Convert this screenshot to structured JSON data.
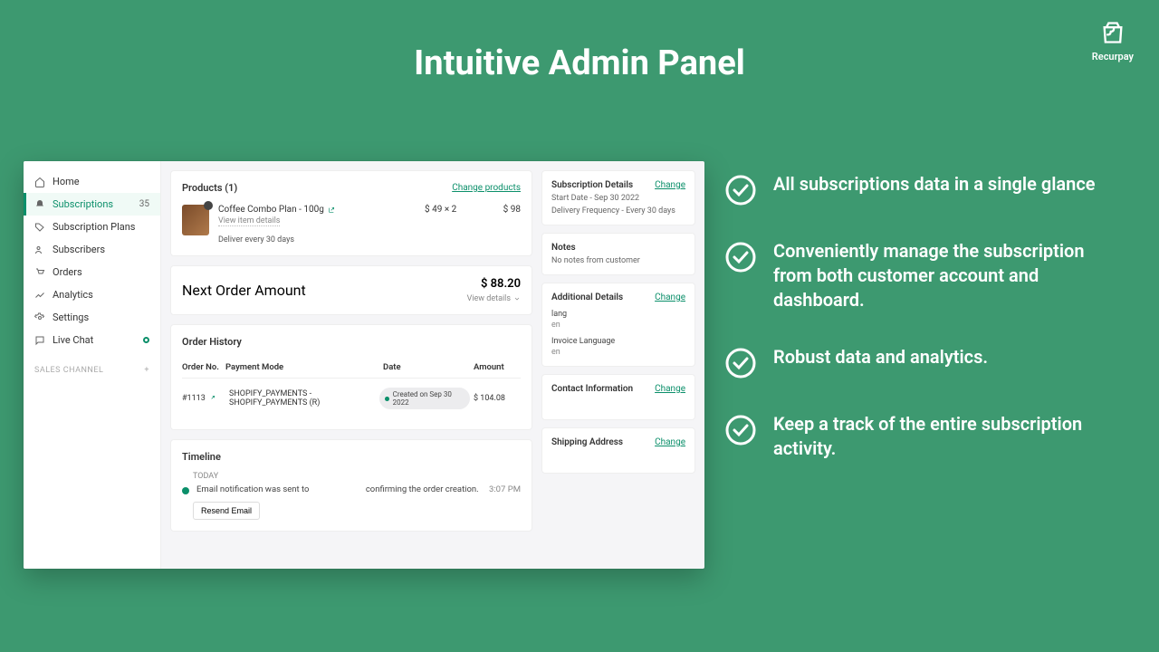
{
  "hero": {
    "title": "Intuitive Admin Panel"
  },
  "brand": {
    "name": "Recurpay"
  },
  "features": [
    "All subscriptions data in a single glance",
    "Conveniently manage the subscription from both customer account and dashboard.",
    "Robust data and analytics.",
    "Keep a track of the entire subscription activity."
  ],
  "sidebar": {
    "items": [
      {
        "label": "Home"
      },
      {
        "label": "Subscriptions",
        "badge": "35",
        "active": true
      },
      {
        "label": "Subscription Plans"
      },
      {
        "label": "Subscribers"
      },
      {
        "label": "Orders"
      },
      {
        "label": "Analytics"
      },
      {
        "label": "Settings"
      },
      {
        "label": "Live Chat",
        "live": true
      }
    ],
    "channel_label": "SALES CHANNEL",
    "channel_plus": "+"
  },
  "products": {
    "title": "Products (1)",
    "change": "Change products",
    "item": {
      "name": "Coffee Combo Plan - 100g",
      "view_details": "View item details",
      "frequency": "Deliver every 30 days",
      "unit_price": "$ 49 × 2",
      "line_total": "$ 98"
    }
  },
  "next_order": {
    "label": "Next Order Amount",
    "amount": "$ 88.20",
    "view_details": "View details"
  },
  "order_history": {
    "title": "Order History",
    "headers": {
      "no": "Order No.",
      "mode": "Payment Mode",
      "date": "Date",
      "amount": "Amount"
    },
    "row": {
      "no": "#1113",
      "mode": "SHOPIFY_PAYMENTS - SHOPIFY_PAYMENTS (R)",
      "date_pill": "Created on Sep 30 2022",
      "amount": "$ 104.08"
    }
  },
  "timeline": {
    "title": "Timeline",
    "today": "TODAY",
    "msg_pre": "Email notification was sent to",
    "msg_post": "confirming the order creation.",
    "time": "3:07 PM",
    "resend": "Resend Email"
  },
  "right": {
    "sub": {
      "title": "Subscription Details",
      "change": "Change",
      "start": "Start Date - Sep 30 2022",
      "freq": "Delivery Frequency - Every 30 days"
    },
    "notes": {
      "title": "Notes",
      "body": "No notes from customer"
    },
    "additional": {
      "title": "Additional Details",
      "change": "Change",
      "k1": "lang",
      "v1": "en",
      "k2": "Invoice Language",
      "v2": "en"
    },
    "contact": {
      "title": "Contact Information",
      "change": "Change"
    },
    "shipping": {
      "title": "Shipping Address",
      "change": "Change"
    }
  }
}
